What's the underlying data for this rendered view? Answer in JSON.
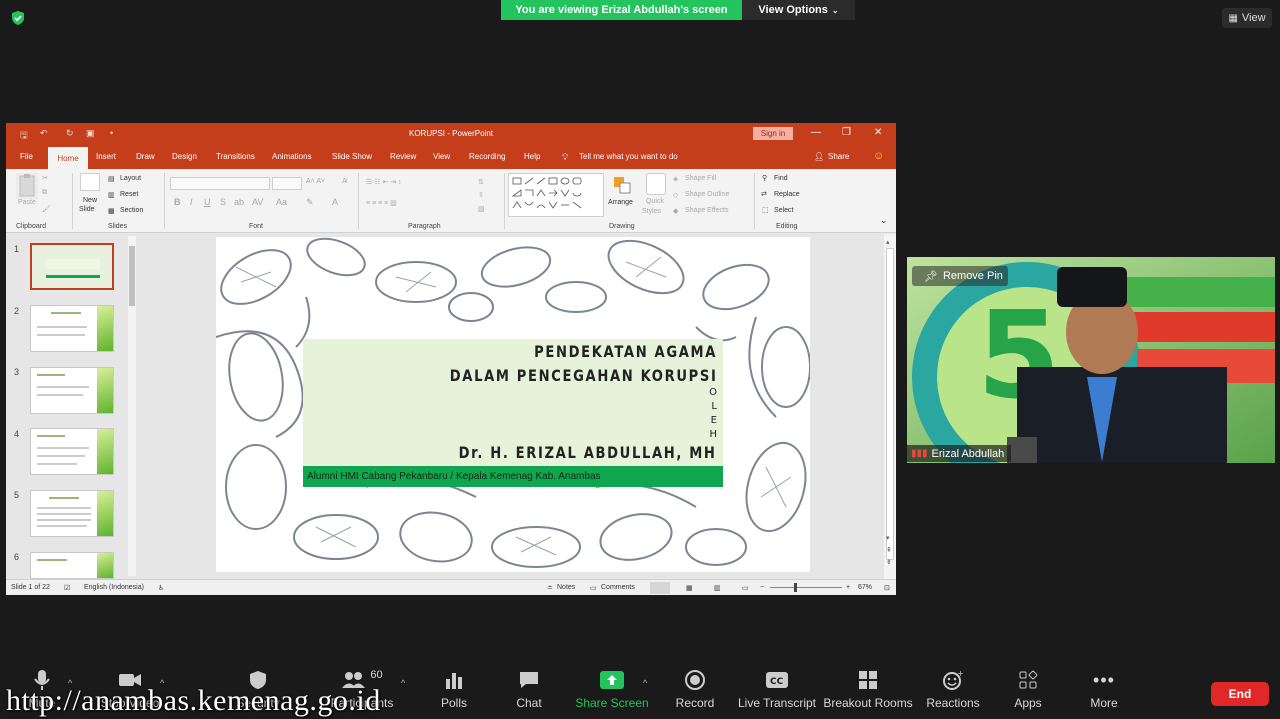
{
  "zoom": {
    "share_banner": "You are viewing Erizal Abdullah's screen",
    "view_options": "View Options",
    "view_label": "View",
    "remove_pin": "Remove Pin",
    "participant_name": "Erizal Abdullah",
    "participant_count": "60",
    "end_label": "End",
    "toolbar": [
      {
        "label": "Mute",
        "icon": "microphone-icon"
      },
      {
        "label": "Stop Video",
        "icon": "video-camera-icon"
      },
      {
        "label": "Security",
        "icon": "shield-icon"
      },
      {
        "label": "Participants",
        "icon": "participants-icon"
      },
      {
        "label": "Polls",
        "icon": "polls-icon"
      },
      {
        "label": "Chat",
        "icon": "chat-icon"
      },
      {
        "label": "Share Screen",
        "icon": "share-screen-icon"
      },
      {
        "label": "Record",
        "icon": "record-icon"
      },
      {
        "label": "Live Transcript",
        "icon": "cc-icon"
      },
      {
        "label": "Breakout Rooms",
        "icon": "breakout-rooms-icon"
      },
      {
        "label": "Reactions",
        "icon": "reactions-icon"
      },
      {
        "label": "Apps",
        "icon": "apps-icon"
      },
      {
        "label": "More",
        "icon": "more-icon"
      }
    ],
    "watermark": "http://anambas.kemenag.go.id",
    "accent_green": "#23c45e",
    "end_red": "#e02828"
  },
  "ppt": {
    "window_title": "KORUPSI  -  PowerPoint",
    "sign_in": "Sign in",
    "tabs": [
      "File",
      "Home",
      "Insert",
      "Draw",
      "Design",
      "Transitions",
      "Animations",
      "Slide Show",
      "Review",
      "View",
      "Recording",
      "Help"
    ],
    "tell_me": "Tell me what you want to do",
    "share": "Share",
    "ribbon": {
      "clipboard": "Clipboard",
      "paste": "Paste",
      "slides": "Slides",
      "new_slide_1": "New",
      "new_slide_2": "Slide",
      "layout": "Layout",
      "reset": "Reset",
      "section": "Section",
      "font": "Font",
      "paragraph": "Paragraph",
      "drawing": "Drawing",
      "arrange": "Arrange",
      "quick_styles_1": "Quick",
      "quick_styles_2": "Styles",
      "shape_fill": "Shape Fill",
      "shape_outline": "Shape Outline",
      "shape_effects": "Shape Effects",
      "editing": "Editing",
      "find": "Find",
      "replace": "Replace",
      "select": "Select"
    },
    "thumbnails": [
      "1",
      "2",
      "3",
      "4",
      "5",
      "6"
    ],
    "slide": {
      "title_line1": "PENDEKATAN AGAMA",
      "title_line2": "DALAM PENCEGAHAN KORUPSI",
      "oleh": [
        "O",
        "L",
        "E",
        "H"
      ],
      "author": "Dr. H. ERIZAL ABDULLAH, MH",
      "subtitle": "Alumni HMI Cabang Pekanbaru / Kepala Kemenag Kab. Anambas",
      "box_color": "#e6f2d9",
      "bar_color": "#12a550"
    },
    "status": {
      "slide_of": "Slide 1 of 22",
      "language": "English (Indonesia)",
      "notes": "Notes",
      "comments": "Comments",
      "zoom": "67%"
    },
    "title_color": "#c43e1c"
  }
}
